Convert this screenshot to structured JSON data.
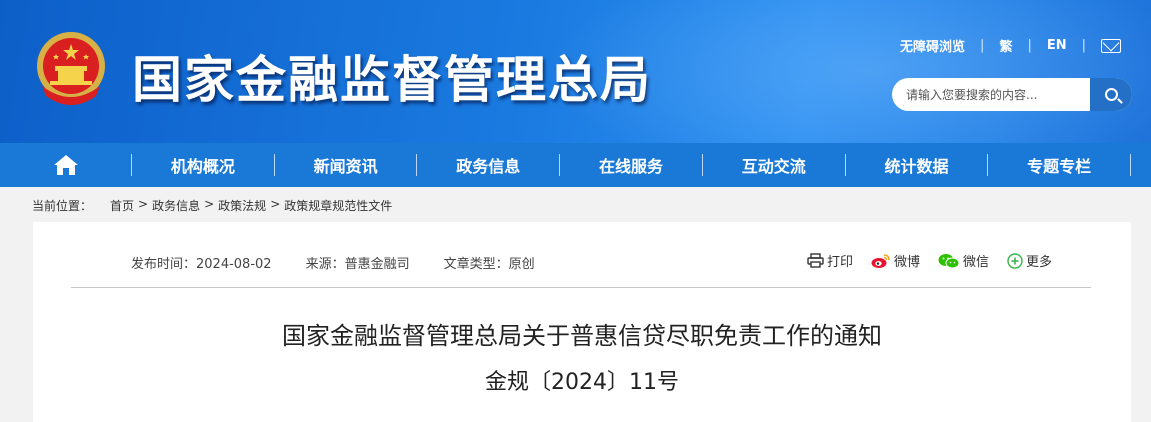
{
  "header": {
    "site_title": "国家金融监督管理总局",
    "accessibility_link": "无障碍浏览",
    "traditional_link": "繁",
    "english_link": "EN",
    "search_placeholder": "请输入您要搜索的内容...",
    "icons": [
      "emblem",
      "mail-icon",
      "search-icon"
    ]
  },
  "nav": {
    "home_icon": "home-icon",
    "items": [
      "机构概况",
      "新闻资讯",
      "政务信息",
      "在线服务",
      "互动交流",
      "统计数据",
      "专题专栏"
    ]
  },
  "breadcrumb": {
    "label": "当前位置：",
    "items": [
      "首页",
      "政务信息",
      "政策法规",
      "政策规章规范性文件"
    ],
    "separator": ">"
  },
  "article": {
    "publish_time": "发布时间：2024-08-02",
    "source": "来源：普惠金融司",
    "type": "文章类型：原创",
    "share": {
      "print": "打印",
      "weibo": "微博",
      "wechat": "微信",
      "more": "更多"
    },
    "title": "国家金融监督管理总局关于普惠信贷尽职免责工作的通知",
    "doc_number": "金规〔2024〕11号"
  },
  "colors": {
    "header_blue": "#1a7ae0",
    "nav_blue": "#1a78d6",
    "search_button": "#2470c6",
    "background": "#f2f2f2"
  }
}
